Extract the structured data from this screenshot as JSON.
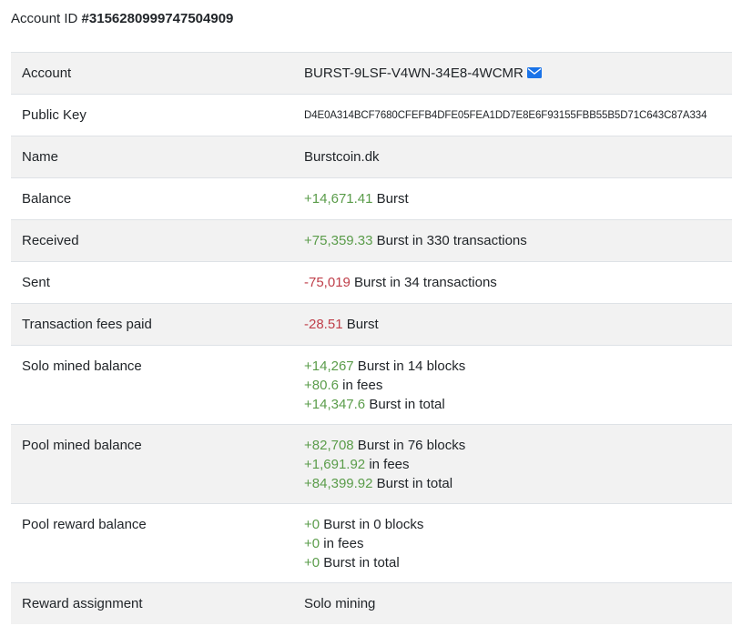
{
  "header": {
    "label": "Account ID",
    "id": "#3156280999747504909"
  },
  "rows": {
    "account": {
      "label": "Account",
      "value": "BURST-9LSF-V4WN-34E8-4WCMR"
    },
    "public_key": {
      "label": "Public Key",
      "value": "D4E0A314BCF7680CFEFB4DFE05FEA1DD7E8E6F93155FBB55B5D71C643C87A334"
    },
    "name": {
      "label": "Name",
      "value": "Burstcoin.dk"
    },
    "balance": {
      "label": "Balance",
      "amount": "+14,671.41",
      "suffix": " Burst"
    },
    "received": {
      "label": "Received",
      "amount": "+75,359.33",
      "suffix": " Burst in 330 transactions"
    },
    "sent": {
      "label": "Sent",
      "amount": "-75,019",
      "suffix": " Burst in 34 transactions"
    },
    "fees": {
      "label": "Transaction fees paid",
      "amount": "-28.51",
      "suffix": " Burst"
    },
    "solo": {
      "label": "Solo mined balance",
      "lines": [
        {
          "amount": "+14,267",
          "suffix": " Burst in 14 blocks"
        },
        {
          "amount": "+80.6",
          "suffix": " in fees"
        },
        {
          "amount": "+14,347.6",
          "suffix": " Burst in total"
        }
      ]
    },
    "pool": {
      "label": "Pool mined balance",
      "lines": [
        {
          "amount": "+82,708",
          "suffix": " Burst in 76 blocks"
        },
        {
          "amount": "+1,691.92",
          "suffix": " in fees"
        },
        {
          "amount": "+84,399.92",
          "suffix": " Burst in total"
        }
      ]
    },
    "pool_reward": {
      "label": "Pool reward balance",
      "lines": [
        {
          "amount": "+0",
          "suffix": " Burst in 0 blocks"
        },
        {
          "amount": "+0",
          "suffix": " in fees"
        },
        {
          "amount": "+0",
          "suffix": " Burst in total"
        }
      ]
    },
    "reward_assignment": {
      "label": "Reward assignment",
      "value": "Solo mining"
    }
  },
  "colors": {
    "positive": "#5a9c4a",
    "negative": "#bf3f4a",
    "mail_icon": "#1a73e8",
    "stripe": "#f2f2f2"
  },
  "icons": {
    "mail": "envelope-icon"
  }
}
